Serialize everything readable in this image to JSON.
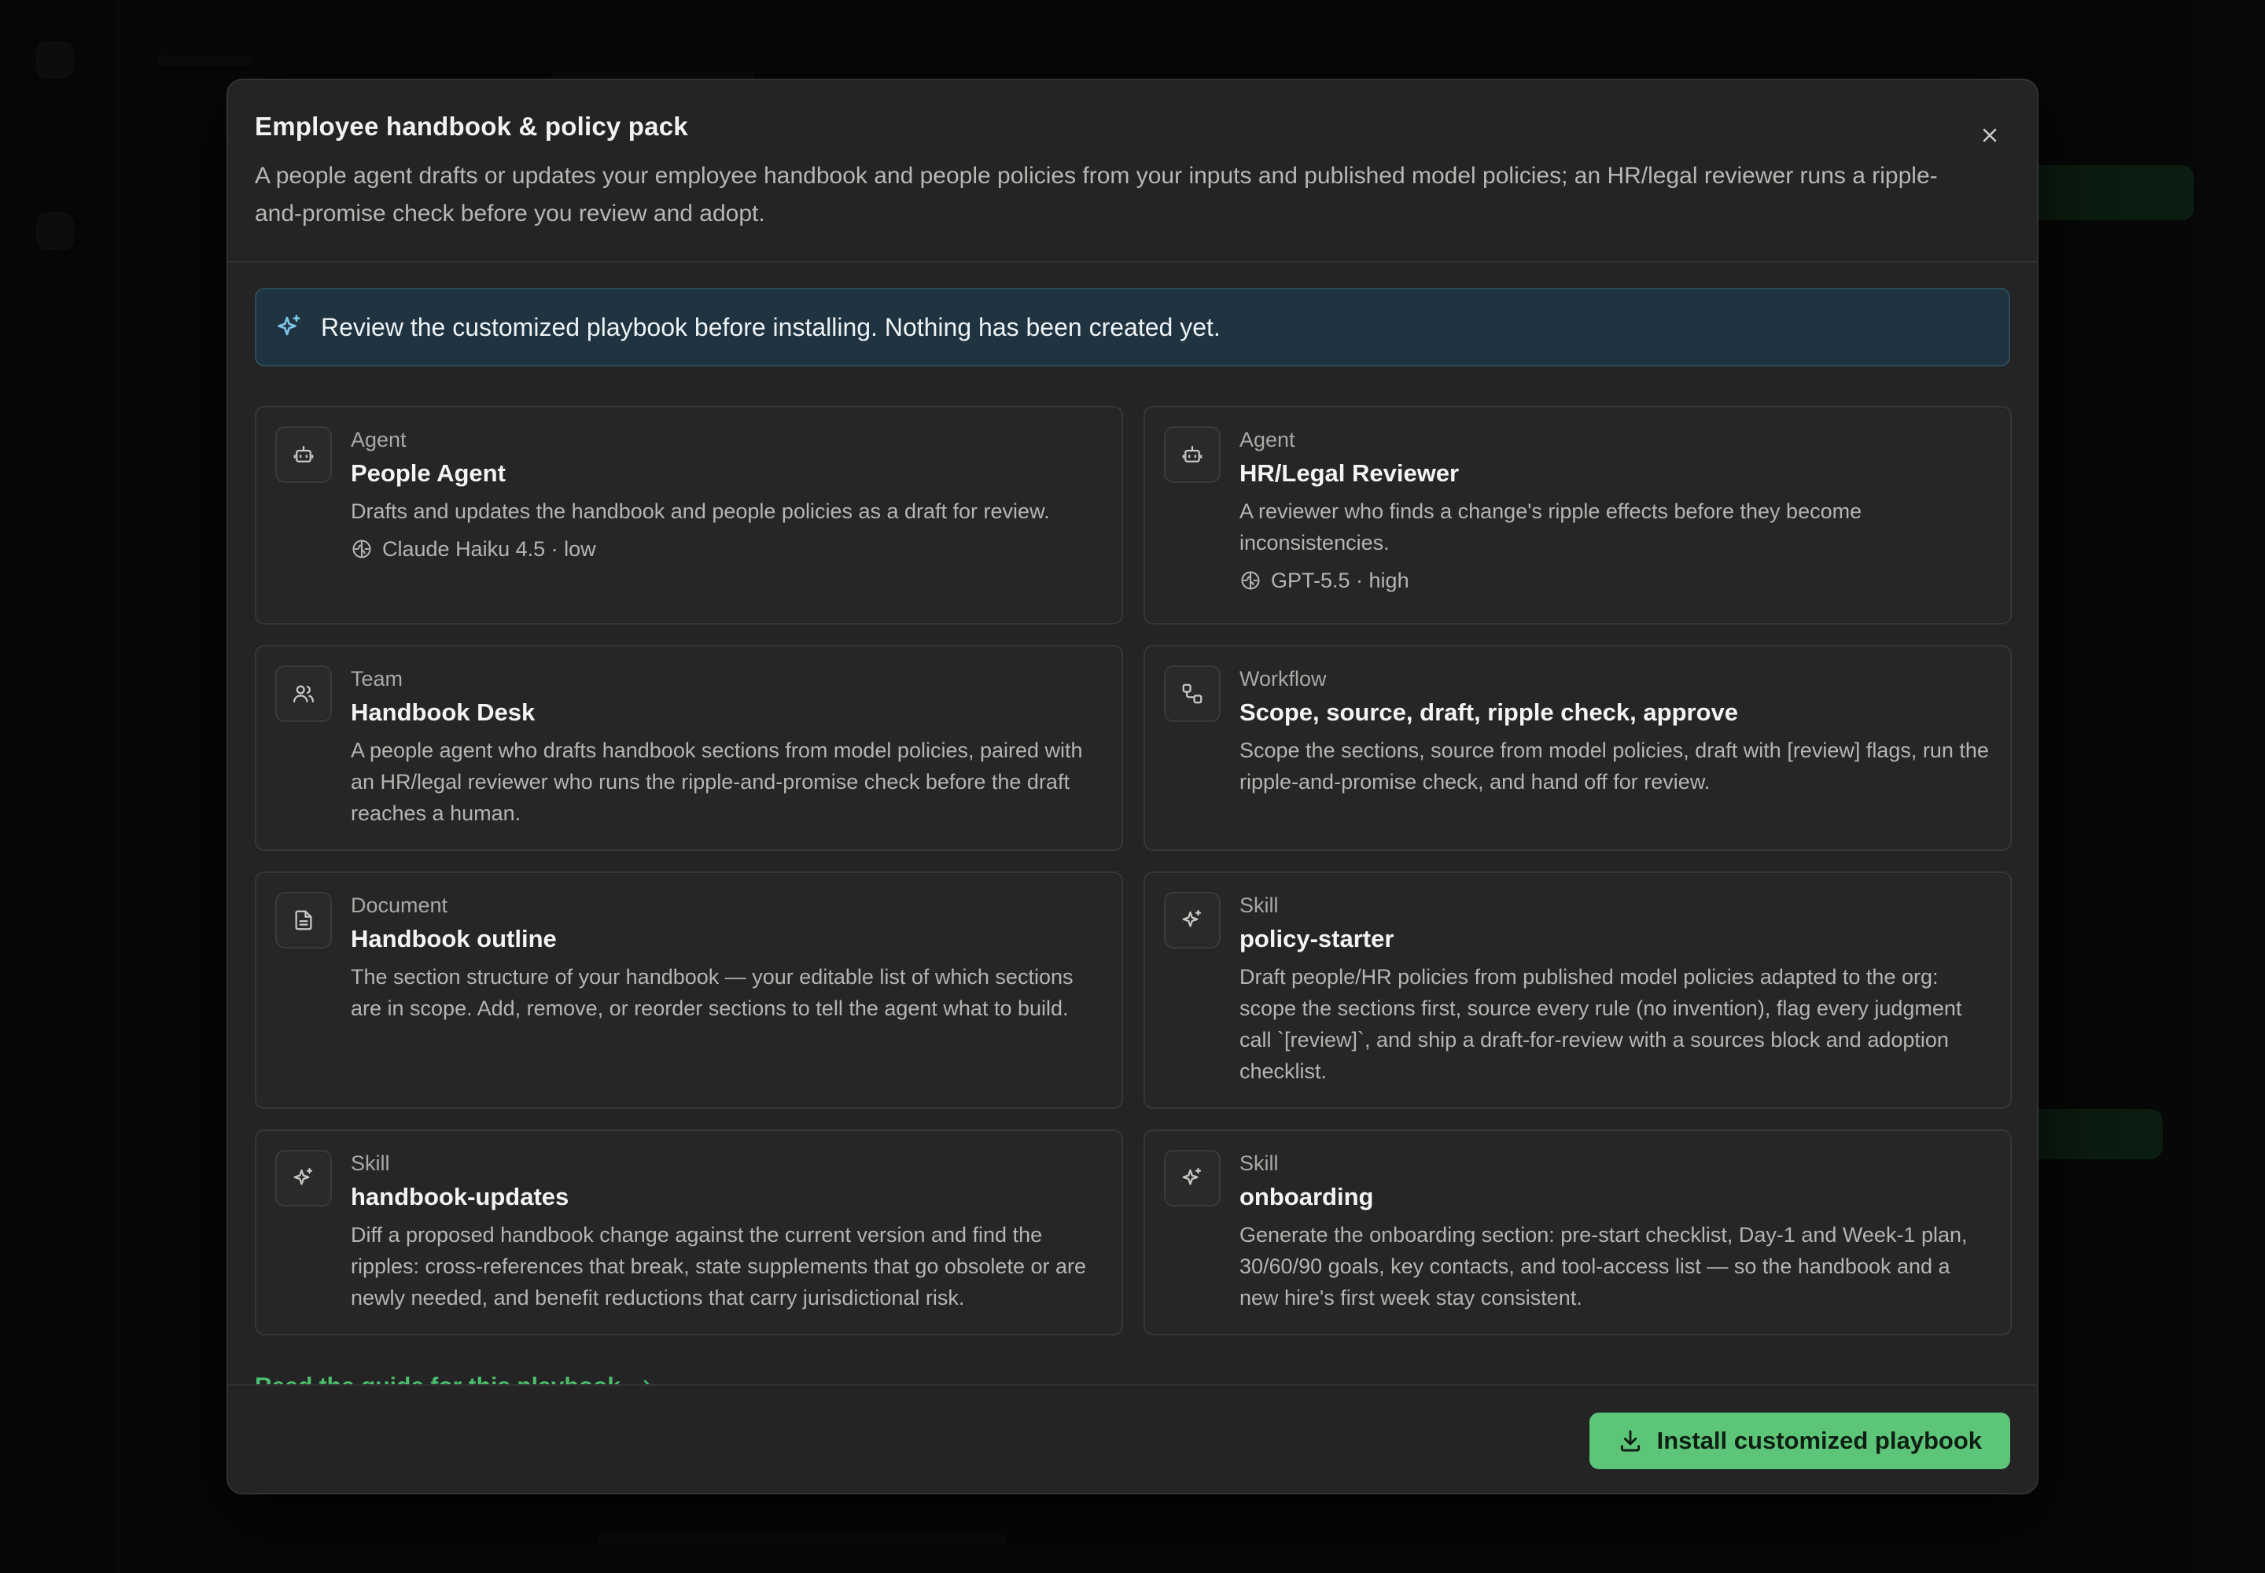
{
  "modal": {
    "title": "Employee handbook & policy pack",
    "description": "A people agent drafts or updates your employee handbook and people policies from your inputs and published model policies; an HR/legal reviewer runs a ripple-and-promise check before you review and adopt.",
    "close_icon": "close-icon"
  },
  "banner": {
    "icon": "sparkle-icon",
    "text": "Review the customized playbook before installing. Nothing has been created yet."
  },
  "cards": [
    {
      "icon": "bot-icon",
      "kind": "Agent",
      "title": "People Agent",
      "description": "Drafts and updates the handbook and people policies as a draft for review.",
      "model": "Claude Haiku 4.5 · low"
    },
    {
      "icon": "bot-icon",
      "kind": "Agent",
      "title": "HR/Legal Reviewer",
      "description": "A reviewer who finds a change's ripple effects before they become inconsistencies.",
      "model": "GPT-5.5 · high"
    },
    {
      "icon": "users-icon",
      "kind": "Team",
      "title": "Handbook Desk",
      "description": "A people agent who drafts handbook sections from model policies, paired with an HR/legal reviewer who runs the ripple-and-promise check before the draft reaches a human."
    },
    {
      "icon": "workflow-icon",
      "kind": "Workflow",
      "title": "Scope, source, draft, ripple check, approve",
      "description": "Scope the sections, source from model policies, draft with [review] flags, run the ripple-and-promise check, and hand off for review."
    },
    {
      "icon": "document-icon",
      "kind": "Document",
      "title": "Handbook outline",
      "description": "The section structure of your handbook — your editable list of which sections are in scope. Add, remove, or reorder sections to tell the agent what to build."
    },
    {
      "icon": "sparkle-icon",
      "kind": "Skill",
      "title": "policy-starter",
      "description": "Draft people/HR policies from published model policies adapted to the org: scope the sections first, source every rule (no invention), flag every judgment call `[review]`, and ship a draft-for-review with a sources block and adoption checklist."
    },
    {
      "icon": "sparkle-icon",
      "kind": "Skill",
      "title": "handbook-updates",
      "description": "Diff a proposed handbook change against the current version and find the ripples: cross-references that break, state supplements that go obsolete or are newly needed, and benefit reductions that carry jurisdictional risk."
    },
    {
      "icon": "sparkle-icon",
      "kind": "Skill",
      "title": "onboarding",
      "description": "Generate the onboarding section: pre-start checklist, Day-1 and Week-1 plan, 30/60/90 goals, key contacts, and tool-access list — so the handbook and a new hire's first week stay consistent."
    }
  ],
  "guide_link": {
    "label": "Read the guide for this playbook",
    "icon": "arrow-right-icon"
  },
  "footer": {
    "install_label": "Install customized playbook",
    "install_icon": "download-icon"
  },
  "colors": {
    "accent": "#5cc578",
    "banner_bg": "#1f3340",
    "modal_bg": "#242424"
  }
}
